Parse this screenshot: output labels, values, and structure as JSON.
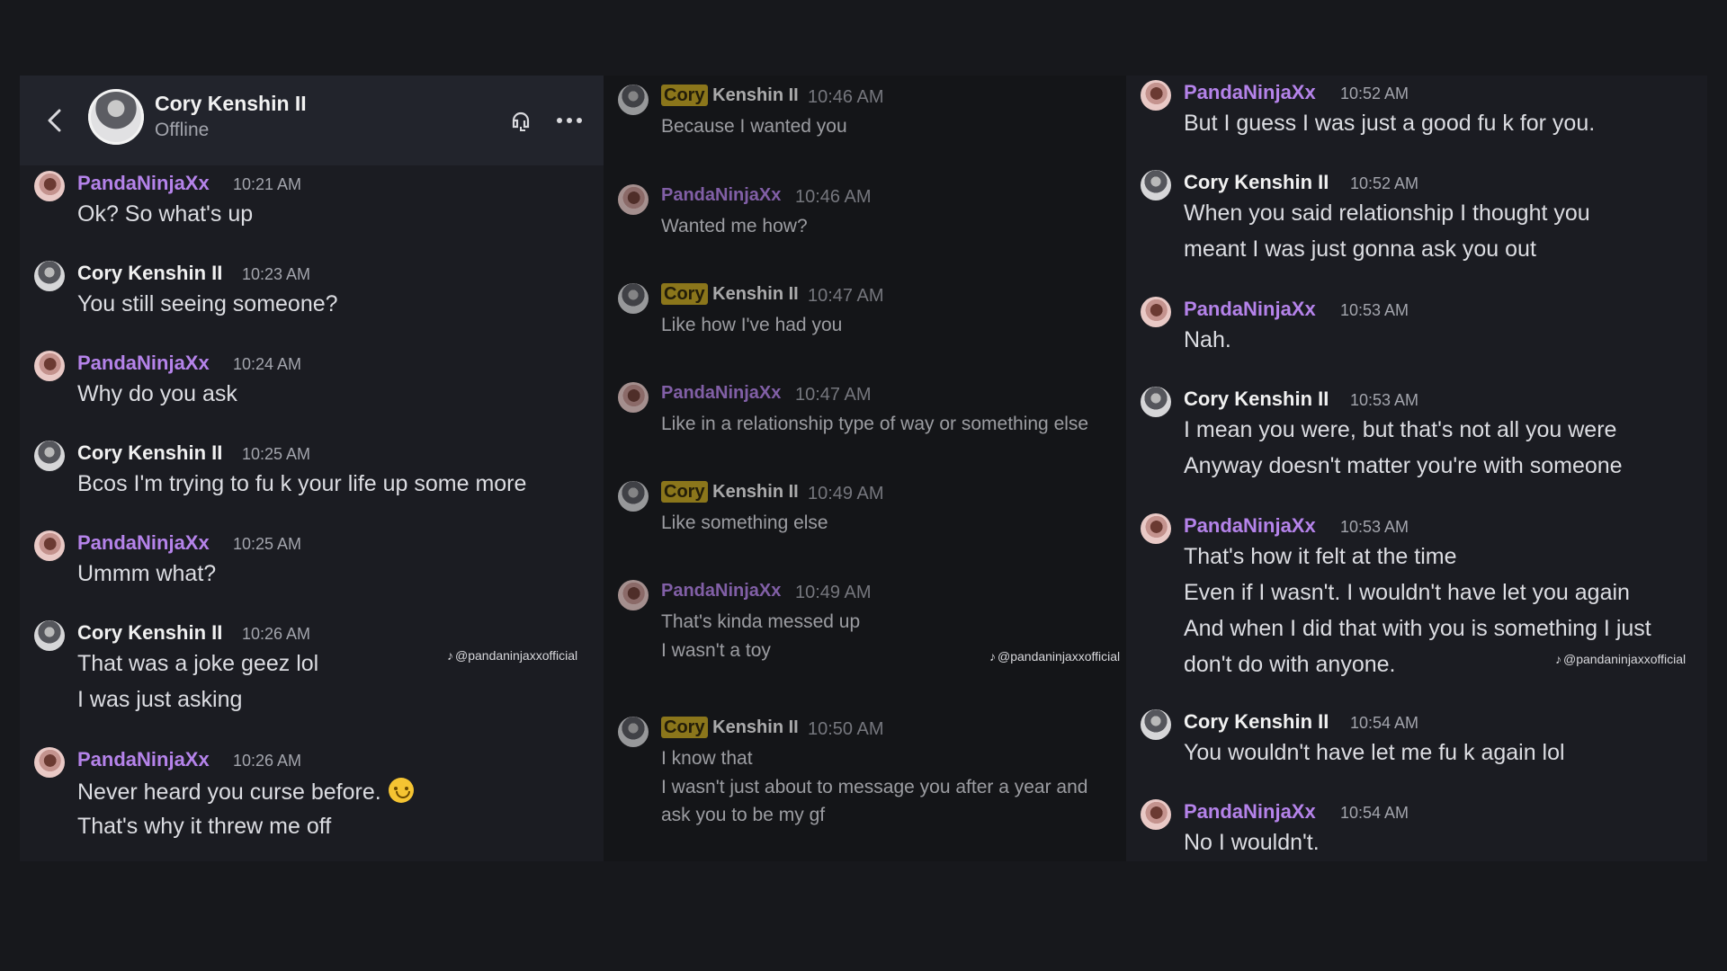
{
  "header": {
    "name": "Cory Kenshin II",
    "status": "Offline"
  },
  "watermark": "@pandaninjaxxofficial",
  "panel1": [
    {
      "author": "PandaNinjaXx",
      "time": "10:21 AM",
      "lines": [
        "Ok? So what's up"
      ]
    },
    {
      "author": "Cory Kenshin II",
      "time": "10:23 AM",
      "lines": [
        "You still seeing someone?"
      ]
    },
    {
      "author": "PandaNinjaXx",
      "time": "10:24 AM",
      "lines": [
        "Why do you ask"
      ]
    },
    {
      "author": "Cory Kenshin II",
      "time": "10:25 AM",
      "lines": [
        "Bcos I'm trying to fu   k your life up some more"
      ]
    },
    {
      "author": "PandaNinjaXx",
      "time": "10:25 AM",
      "lines": [
        "Ummm what?"
      ]
    },
    {
      "author": "Cory Kenshin II",
      "time": "10:26 AM",
      "lines": [
        "That was a joke geez lol",
        "I was just asking"
      ]
    },
    {
      "author": "PandaNinjaXx",
      "time": "10:26 AM",
      "lines": [
        "Never heard you curse before.",
        "That's why it threw me off"
      ]
    }
  ],
  "panel2": [
    {
      "author_tag": "Cory",
      "author_rest": " Kenshin II",
      "time": "10:46 AM",
      "lines": [
        "Because I wanted you"
      ]
    },
    {
      "author": "PandaNinjaXx",
      "time": "10:46 AM",
      "lines": [
        "Wanted me how?"
      ]
    },
    {
      "author_tag": "Cory",
      "author_rest": " Kenshin II",
      "time": "10:47 AM",
      "lines": [
        "Like how I've had you"
      ]
    },
    {
      "author": "PandaNinjaXx",
      "time": "10:47 AM",
      "lines": [
        "Like in a relationship type of way or something else"
      ]
    },
    {
      "author_tag": "Cory",
      "author_rest": " Kenshin II",
      "time": "10:49 AM",
      "lines": [
        "Like something else"
      ]
    },
    {
      "author": "PandaNinjaXx",
      "time": "10:49 AM",
      "lines": [
        "That's kinda messed up",
        "I wasn't a toy"
      ]
    },
    {
      "author_tag": "Cory",
      "author_rest": " Kenshin II",
      "time": "10:50 AM",
      "lines": [
        "I know that",
        "I wasn't just about to message you after a year and",
        "ask you to be my gf"
      ]
    }
  ],
  "panel3": [
    {
      "author": "PandaNinjaXx",
      "time": "10:52 AM",
      "lines": [
        "But I guess I was just a good fu   k for you."
      ]
    },
    {
      "author": "Cory Kenshin II",
      "time": "10:52 AM",
      "lines": [
        "When you said relationship I thought you",
        "meant I was just gonna ask you out"
      ]
    },
    {
      "author": "PandaNinjaXx",
      "time": "10:53 AM",
      "lines": [
        "Nah."
      ]
    },
    {
      "author": "Cory Kenshin II",
      "time": "10:53 AM",
      "lines": [
        "I mean you were, but that's not all you were",
        "Anyway doesn't matter you're with someone"
      ]
    },
    {
      "author": "PandaNinjaXx",
      "time": "10:53 AM",
      "lines": [
        "That's how it felt at the time",
        "Even if I wasn't. I wouldn't have let you again",
        "And when I did that with you is something I just",
        "don't do with anyone."
      ]
    },
    {
      "author": "Cory Kenshin II",
      "time": "10:54 AM",
      "lines": [
        "You wouldn't have let me fu   k again lol"
      ]
    },
    {
      "author": "PandaNinjaXx",
      "time": "10:54 AM",
      "lines": [
        "No I wouldn't."
      ]
    }
  ]
}
